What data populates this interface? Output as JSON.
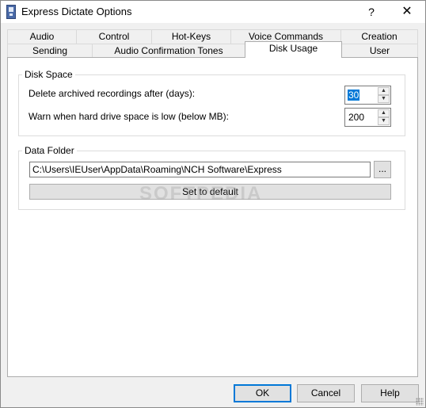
{
  "window": {
    "title": "Express Dictate Options",
    "help_glyph": "?",
    "close_glyph": "✕"
  },
  "tabs": {
    "row1": [
      "Audio",
      "Control",
      "Hot-Keys",
      "Voice Commands",
      "Creation"
    ],
    "row2": [
      "Sending",
      "Audio Confirmation Tones",
      "Disk Usage",
      "User"
    ],
    "active": "Disk Usage"
  },
  "disk_space": {
    "group_label": "Disk Space",
    "archive_label": "Delete archived recordings after (days):",
    "archive_value": "30",
    "warn_label": "Warn when hard drive space is low (below MB):",
    "warn_value": "200"
  },
  "data_folder": {
    "group_label": "Data Folder",
    "path_value": "C:\\Users\\IEUser\\AppData\\Roaming\\NCH Software\\Express",
    "browse_label": "...",
    "default_label": "Set to default"
  },
  "watermark": "SOFTPEDIA",
  "footer": {
    "ok_label": "OK",
    "cancel_label": "Cancel",
    "help_label": "Help"
  }
}
